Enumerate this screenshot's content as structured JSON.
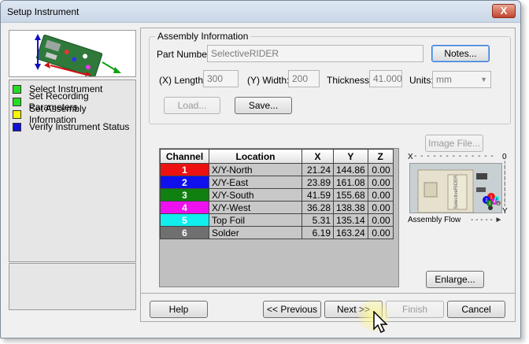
{
  "window": {
    "title": "Setup Instrument",
    "close_label": "X"
  },
  "steps": [
    {
      "label": "Select Instrument",
      "color": "#22dd22"
    },
    {
      "label": "Set Recording Parameters",
      "color": "#22dd22"
    },
    {
      "label": "Set Assembly Information",
      "color": "#f5f500"
    },
    {
      "label": "Verify Instrument Status",
      "color": "#1010d8"
    }
  ],
  "assembly": {
    "group_label": "Assembly Information",
    "part_number_label": "Part Number:",
    "part_number_value": "SelectiveRIDER",
    "notes_button": "Notes...",
    "length_label": "(X) Length:",
    "length_value": "300",
    "width_label": "(Y) Width:",
    "width_value": "200",
    "thickness_label": "Thickness:",
    "thickness_value": "41.000",
    "units_label": "Units:",
    "units_value": "mm",
    "load_button": "Load...",
    "save_button": "Save..."
  },
  "image_file_button": "Image File...",
  "table": {
    "headers": [
      "Channel",
      "Location",
      "X",
      "Y",
      "Z"
    ],
    "rows": [
      {
        "channel": "1",
        "color": "#ee1111",
        "location": "X/Y-North",
        "x": "21.24",
        "y": "144.86",
        "z": "0.00"
      },
      {
        "channel": "2",
        "color": "#1010ee",
        "location": "X/Y-East",
        "x": "23.89",
        "y": "161.08",
        "z": "0.00"
      },
      {
        "channel": "3",
        "color": "#108010",
        "location": "X/Y-South",
        "x": "41.59",
        "y": "155.68",
        "z": "0.00"
      },
      {
        "channel": "4",
        "color": "#ee10ee",
        "location": "X/Y-West",
        "x": "36.28",
        "y": "138.38",
        "z": "0.00"
      },
      {
        "channel": "5",
        "color": "#10eeee",
        "location": "Top Foil",
        "x": "5.31",
        "y": "135.14",
        "z": "0.00"
      },
      {
        "channel": "6",
        "color": "#707070",
        "location": "Solder",
        "x": "6.19",
        "y": "163.24",
        "z": "0.00"
      }
    ]
  },
  "assy_view": {
    "x_label": "X",
    "zero_label": "0",
    "y_label": "Y",
    "caption": "Assembly Flow",
    "board_text": "SelectiveRIDER",
    "marker_labels": [
      "1",
      "2",
      "3",
      "4",
      "5",
      "6"
    ]
  },
  "enlarge_button": "Enlarge...",
  "nav": {
    "help": "Help",
    "previous": "<< Previous",
    "next": "Next >>",
    "finish": "Finish",
    "cancel": "Cancel"
  }
}
